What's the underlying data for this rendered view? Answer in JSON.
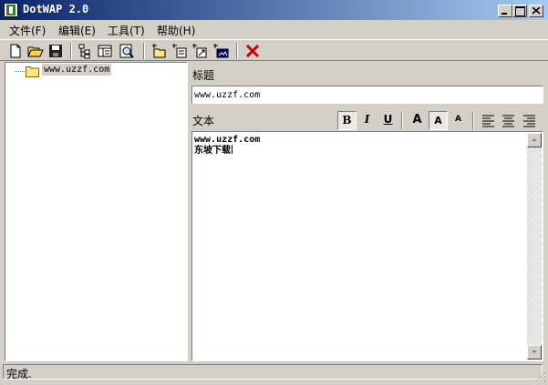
{
  "window": {
    "title": "DotWAP 2.0"
  },
  "menu": [
    {
      "label": "文件(F)"
    },
    {
      "label": "编辑(E)"
    },
    {
      "label": "工具(T)"
    },
    {
      "label": "帮助(H)"
    }
  ],
  "toolbar": {
    "buttons": [
      "new-file-icon",
      "open-folder-icon",
      "save-icon",
      "tree-view-icon",
      "properties-icon",
      "preview-icon",
      "add-folder-icon",
      "add-item-icon",
      "add-link-icon",
      "add-image-icon",
      "delete-icon"
    ]
  },
  "tree": {
    "items": [
      {
        "label": "www.uzzf.com"
      }
    ]
  },
  "editor": {
    "title_label": "标题",
    "title_value": "www.uzzf.com",
    "text_label": "文本",
    "format": {
      "bold": "B",
      "italic": "I",
      "underline": "U",
      "font_large": "A",
      "font_medium": "A",
      "font_small": "A"
    },
    "lines": [
      "www.uzzf.com",
      "东坡下载"
    ]
  },
  "status": {
    "text": "完成."
  },
  "colors": {
    "title_start": "#0a246a",
    "title_end": "#a6caf0",
    "face": "#d4d0c8",
    "delete_red": "#cc0000"
  }
}
